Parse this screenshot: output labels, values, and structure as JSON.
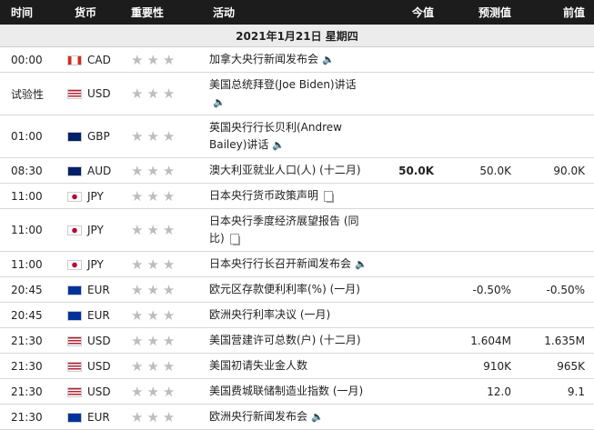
{
  "headers": {
    "time": "时间",
    "currency": "货币",
    "importance": "重要性",
    "event": "活动",
    "actual": "今值",
    "forecast": "预测值",
    "previous": "前值"
  },
  "date_row": "2021年1月21日 星期四",
  "rows": [
    {
      "time": "00:00",
      "currency": "CAD",
      "flag": "ca",
      "event": "加拿大央行新闻发布会",
      "icon": "speaker-icon",
      "actual": "",
      "forecast": "",
      "previous": ""
    },
    {
      "time": "试验性",
      "currency": "USD",
      "flag": "us",
      "event": "美国总统拜登(Joe Biden)讲话",
      "icon": "speaker-icon",
      "actual": "",
      "forecast": "",
      "previous": ""
    },
    {
      "time": "01:00",
      "currency": "GBP",
      "flag": "gb",
      "event": "英国央行行长贝利(Andrew Bailey)讲话",
      "icon": "speaker-icon",
      "actual": "",
      "forecast": "",
      "previous": ""
    },
    {
      "time": "08:30",
      "currency": "AUD",
      "flag": "au",
      "event": "澳大利亚就业人口(人) (十二月)",
      "icon": "",
      "actual": "50.0K",
      "forecast": "50.0K",
      "previous": "90.0K"
    },
    {
      "time": "11:00",
      "currency": "JPY",
      "flag": "jp",
      "event": "日本央行货币政策声明",
      "icon": "document-icon",
      "actual": "",
      "forecast": "",
      "previous": ""
    },
    {
      "time": "11:00",
      "currency": "JPY",
      "flag": "jp",
      "event": "日本央行季度经济展望报告 (同比)",
      "icon": "document-icon",
      "actual": "",
      "forecast": "",
      "previous": ""
    },
    {
      "time": "11:00",
      "currency": "JPY",
      "flag": "jp",
      "event": "日本央行行长召开新闻发布会",
      "icon": "speaker-icon",
      "actual": "",
      "forecast": "",
      "previous": ""
    },
    {
      "time": "20:45",
      "currency": "EUR",
      "flag": "eu",
      "event": "欧元区存款便利利率(%) (一月)",
      "icon": "",
      "actual": "",
      "forecast": "-0.50%",
      "previous": "-0.50%"
    },
    {
      "time": "20:45",
      "currency": "EUR",
      "flag": "eu",
      "event": "欧洲央行利率决议 (一月)",
      "icon": "",
      "actual": "",
      "forecast": "",
      "previous": ""
    },
    {
      "time": "21:30",
      "currency": "USD",
      "flag": "us",
      "event": "美国营建许可总数(户) (十二月)",
      "icon": "",
      "actual": "",
      "forecast": "1.604M",
      "previous": "1.635M"
    },
    {
      "time": "21:30",
      "currency": "USD",
      "flag": "us",
      "event": "美国初请失业金人数",
      "icon": "",
      "actual": "",
      "forecast": "910K",
      "previous": "965K"
    },
    {
      "time": "21:30",
      "currency": "USD",
      "flag": "us",
      "event": "美国费城联储制造业指数 (一月)",
      "icon": "",
      "actual": "",
      "forecast": "12.0",
      "previous": "9.1"
    },
    {
      "time": "21:30",
      "currency": "EUR",
      "flag": "eu",
      "event": "欧洲央行新闻发布会",
      "icon": "speaker-icon",
      "actual": "",
      "forecast": "",
      "previous": ""
    }
  ]
}
